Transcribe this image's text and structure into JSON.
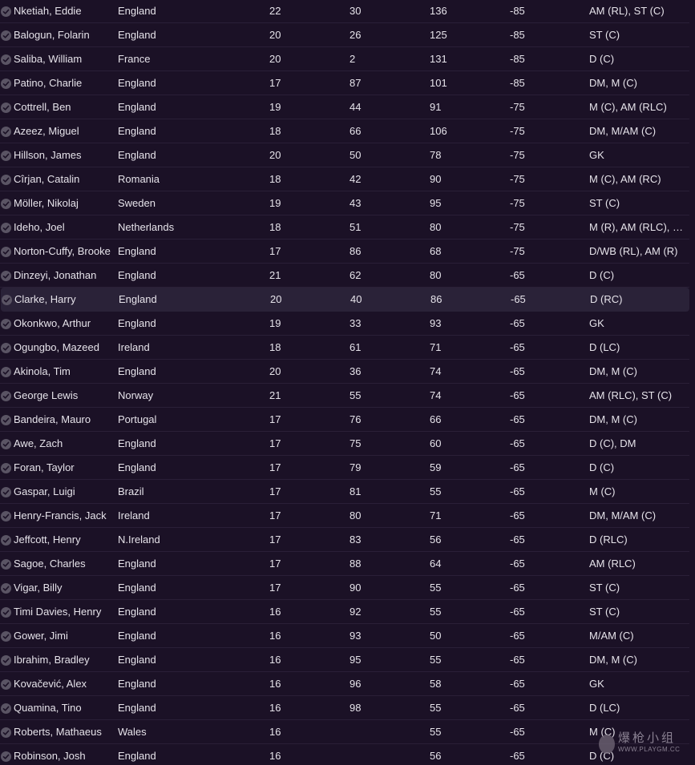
{
  "players": [
    {
      "name": "Nketiah, Eddie",
      "nationality": "England",
      "age": "22",
      "ca": "30",
      "pa": "136",
      "value": "-85",
      "position": "AM (RL), ST (C)"
    },
    {
      "name": "Balogun, Folarin",
      "nationality": "England",
      "age": "20",
      "ca": "26",
      "pa": "125",
      "value": "-85",
      "position": "ST (C)"
    },
    {
      "name": "Saliba, William",
      "nationality": "France",
      "age": "20",
      "ca": "2",
      "pa": "131",
      "value": "-85",
      "position": "D (C)"
    },
    {
      "name": "Patino, Charlie",
      "nationality": "England",
      "age": "17",
      "ca": "87",
      "pa": "101",
      "value": "-85",
      "position": "DM, M (C)"
    },
    {
      "name": "Cottrell, Ben",
      "nationality": "England",
      "age": "19",
      "ca": "44",
      "pa": "91",
      "value": "-75",
      "position": "M (C), AM (RLC)"
    },
    {
      "name": "Azeez, Miguel",
      "nationality": "England",
      "age": "18",
      "ca": "66",
      "pa": "106",
      "value": "-75",
      "position": "DM, M/AM (C)"
    },
    {
      "name": "Hillson, James",
      "nationality": "England",
      "age": "20",
      "ca": "50",
      "pa": "78",
      "value": "-75",
      "position": "GK"
    },
    {
      "name": "Cîrjan, Catalin",
      "nationality": "Romania",
      "age": "18",
      "ca": "42",
      "pa": "90",
      "value": "-75",
      "position": "M (C), AM (RC)"
    },
    {
      "name": "Möller, Nikolaj",
      "nationality": "Sweden",
      "age": "19",
      "ca": "43",
      "pa": "95",
      "value": "-75",
      "position": "ST (C)"
    },
    {
      "name": "Ideho, Joel",
      "nationality": "Netherlands",
      "age": "18",
      "ca": "51",
      "pa": "80",
      "value": "-75",
      "position": "M (R), AM (RLC), ST..."
    },
    {
      "name": "Norton-Cuffy, Brooke",
      "nationality": "England",
      "age": "17",
      "ca": "86",
      "pa": "68",
      "value": "-75",
      "position": "D/WB (RL), AM (R)"
    },
    {
      "name": "Dinzeyi, Jonathan",
      "nationality": "England",
      "age": "21",
      "ca": "62",
      "pa": "80",
      "value": "-65",
      "position": "D (C)"
    },
    {
      "name": "Clarke, Harry",
      "nationality": "England",
      "age": "20",
      "ca": "40",
      "pa": "86",
      "value": "-65",
      "position": "D (RC)",
      "highlighted": true
    },
    {
      "name": "Okonkwo, Arthur",
      "nationality": "England",
      "age": "19",
      "ca": "33",
      "pa": "93",
      "value": "-65",
      "position": "GK"
    },
    {
      "name": "Ogungbo, Mazeed",
      "nationality": "Ireland",
      "age": "18",
      "ca": "61",
      "pa": "71",
      "value": "-65",
      "position": "D (LC)"
    },
    {
      "name": "Akinola, Tim",
      "nationality": "England",
      "age": "20",
      "ca": "36",
      "pa": "74",
      "value": "-65",
      "position": "DM, M (C)"
    },
    {
      "name": "George Lewis",
      "nationality": "Norway",
      "age": "21",
      "ca": "55",
      "pa": "74",
      "value": "-65",
      "position": "AM (RLC), ST (C)"
    },
    {
      "name": "Bandeira, Mauro",
      "nationality": "Portugal",
      "age": "17",
      "ca": "76",
      "pa": "66",
      "value": "-65",
      "position": "DM, M (C)"
    },
    {
      "name": "Awe, Zach",
      "nationality": "England",
      "age": "17",
      "ca": "75",
      "pa": "60",
      "value": "-65",
      "position": "D (C), DM"
    },
    {
      "name": "Foran, Taylor",
      "nationality": "England",
      "age": "17",
      "ca": "79",
      "pa": "59",
      "value": "-65",
      "position": "D (C)"
    },
    {
      "name": "Gaspar, Luigi",
      "nationality": "Brazil",
      "age": "17",
      "ca": "81",
      "pa": "55",
      "value": "-65",
      "position": "M (C)"
    },
    {
      "name": "Henry-Francis, Jack",
      "nationality": "Ireland",
      "age": "17",
      "ca": "80",
      "pa": "71",
      "value": "-65",
      "position": "DM, M/AM (C)"
    },
    {
      "name": "Jeffcott, Henry",
      "nationality": "N.Ireland",
      "age": "17",
      "ca": "83",
      "pa": "56",
      "value": "-65",
      "position": "D (RLC)"
    },
    {
      "name": "Sagoe, Charles",
      "nationality": "England",
      "age": "17",
      "ca": "88",
      "pa": "64",
      "value": "-65",
      "position": "AM (RLC)"
    },
    {
      "name": "Vigar, Billy",
      "nationality": "England",
      "age": "17",
      "ca": "90",
      "pa": "55",
      "value": "-65",
      "position": "ST (C)"
    },
    {
      "name": "Timi Davies, Henry",
      "nationality": "England",
      "age": "16",
      "ca": "92",
      "pa": "55",
      "value": "-65",
      "position": "ST (C)"
    },
    {
      "name": "Gower, Jimi",
      "nationality": "England",
      "age": "16",
      "ca": "93",
      "pa": "50",
      "value": "-65",
      "position": "M/AM (C)"
    },
    {
      "name": "Ibrahim, Bradley",
      "nationality": "England",
      "age": "16",
      "ca": "95",
      "pa": "55",
      "value": "-65",
      "position": "DM, M (C)"
    },
    {
      "name": "Kovačević, Alex",
      "nationality": "England",
      "age": "16",
      "ca": "96",
      "pa": "58",
      "value": "-65",
      "position": "GK"
    },
    {
      "name": "Quamina, Tino",
      "nationality": "England",
      "age": "16",
      "ca": "98",
      "pa": "55",
      "value": "-65",
      "position": "D (LC)"
    },
    {
      "name": "Roberts, Mathaeus",
      "nationality": "Wales",
      "age": "16",
      "ca": "",
      "pa": "55",
      "value": "-65",
      "position": "M (C)"
    },
    {
      "name": "Robinson, Josh",
      "nationality": "England",
      "age": "16",
      "ca": "",
      "pa": "56",
      "value": "-65",
      "position": "D (C)"
    }
  ],
  "watermark": {
    "text": "爆枪小组",
    "url": "WWW.PLAYGM.CC"
  }
}
